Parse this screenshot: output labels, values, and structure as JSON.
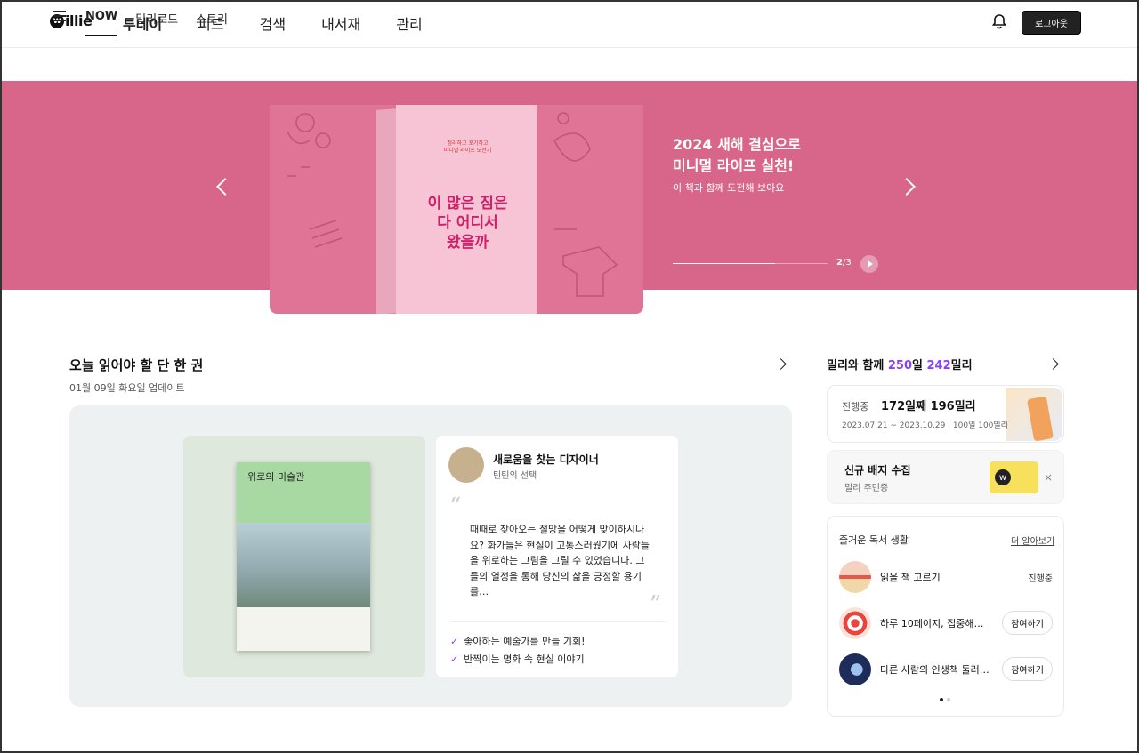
{
  "header": {
    "logo": "millie",
    "menu": [
      "투데이",
      "피드",
      "검색",
      "내서재",
      "관리"
    ],
    "active_menu": "투데이",
    "logout_label": "로그아웃"
  },
  "subnav": {
    "tabs": [
      "NOW",
      "밀리로드",
      "스토리"
    ],
    "active_tab": "NOW"
  },
  "hero": {
    "title": "2024 새해 결심으로\n미니멀 라이프 실천!",
    "subtitle": "이 책과 함께 도전해 보아요",
    "book_title": "이 많은 짐은\n다 어디서\n왔을까",
    "book_subtitle": "정리하고 포기하고\n미니멀 라이프 도전기",
    "page_current": "2",
    "page_sep": "/",
    "page_total": "3",
    "progress": 0.66,
    "background_color": "#d7668a"
  },
  "daily_pick": {
    "title": "오늘 읽어야 할 단 한 권",
    "updated": "01월 09일 화요일 업데이트",
    "book_title": "위로의 미술관",
    "curator_name": "새로움을 찾는 디자이너",
    "curator_role": "틴틴의 선택",
    "quote": "때때로 찾아오는 절망을 어떻게 맞이하시나요? 화가들은 현실이 고통스러웠기에 사람들을 위로하는 그림을 그릴 수 있었습니다. 그들의 열정을 통해 당신의 삶을 긍정할 용기를…",
    "checks": [
      "좋아하는 예술가를 만들 기회!",
      "반짝이는 명화 속 현실 이야기"
    ],
    "accent_color": "#8a3ffc"
  },
  "right": {
    "title_prefix": "밀리와 함께",
    "days": "250",
    "days_unit": "일",
    "millis": "242",
    "millis_unit": "밀리",
    "progress_label": "진행중",
    "progress_value": "172일째 196밀리",
    "progress_dates": "2023.07.21 ~ 2023.10.29 · 100일 100밀리",
    "badge_title": "신규 배지 수집",
    "badge_sub": "밀리 주민증",
    "close_icon": "×",
    "reading_title": "즐거운 독서 생활",
    "reading_more": "더 알아보기",
    "items": [
      {
        "name": "읽을 책 고르기",
        "status": "진행중"
      },
      {
        "name": "하루 10페이지, 집중해서 …",
        "button": "참여하기"
      },
      {
        "name": "다른 사람의 인생책 둘러…",
        "button": "참여하기"
      }
    ]
  }
}
